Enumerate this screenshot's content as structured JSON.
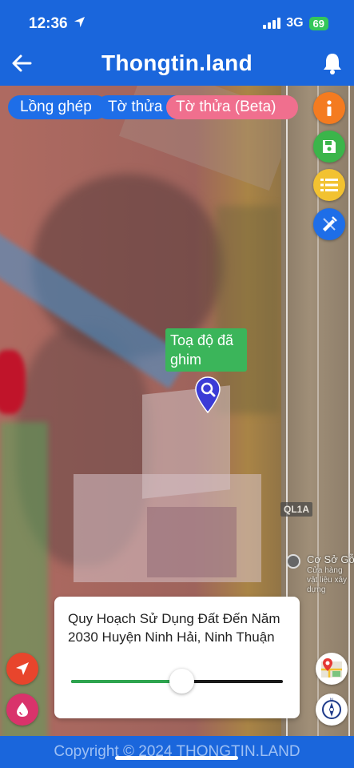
{
  "status_bar": {
    "time": "12:36",
    "network": "3G",
    "battery": "69"
  },
  "header": {
    "title": "Thongtin.land",
    "back_icon": "arrow-left-icon",
    "bell_icon": "bell-icon"
  },
  "layer_tabs": [
    {
      "label": "Lồng ghép",
      "active": false
    },
    {
      "label": "Tờ thửa",
      "active": false
    },
    {
      "label": "Tờ thửa (Beta)",
      "active": true
    }
  ],
  "right_buttons": [
    {
      "icon": "info-icon",
      "color": "#f47b20"
    },
    {
      "icon": "save-icon",
      "color": "#3bb54a"
    },
    {
      "icon": "list-icon",
      "color": "#f2c231"
    },
    {
      "icon": "measure-tool-icon",
      "color": "#1e6ee8"
    }
  ],
  "pin": {
    "label": "Toạ độ đã ghim"
  },
  "map_labels": {
    "road": "QL1A",
    "poi_name": "Cơ Sở Gỗ T",
    "poi_sub": "Cửa hàng vật liệu xây dựng"
  },
  "planning_card": {
    "title": "Quy Hoạch Sử Dụng Đất Đến Năm 2030 Huyện Ninh Hải, Ninh Thuận",
    "opacity": 0.52
  },
  "bottom_buttons": {
    "left": [
      "locate-icon",
      "drop-icon"
    ],
    "right": [
      "map-layers-icon",
      "compass-icon"
    ]
  },
  "footer": {
    "copyright": "Copyright © 2024 THONGTIN.LAND"
  },
  "colors": {
    "brand_blue": "#1a66dc",
    "active_tab": "#f06f8e",
    "pin_label": "#3bb55a"
  }
}
